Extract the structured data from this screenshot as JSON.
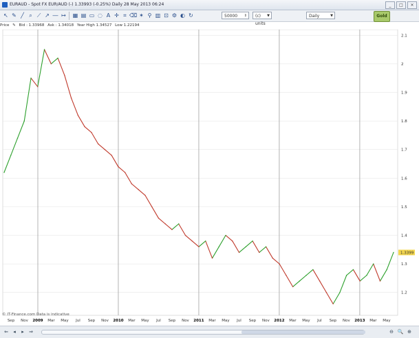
{
  "window": {
    "title": "EURAUD - Spot FX EUR/AUD (-)   1.33993 (-0.25%)   Daily   28 May 2013 06:24",
    "controls": [
      "_",
      "□",
      "×"
    ]
  },
  "toolbar": {
    "icons": [
      "cursor-icon",
      "pencil-icon",
      "line-tool-icon",
      "magnifier-icon",
      "trendline-icon",
      "arrow-line-icon",
      "horizontal-line-icon",
      "vertical-line-icon",
      "fibonacci-icon",
      "channel-icon",
      "rectangle-icon",
      "ellipse-icon",
      "text-icon",
      "crosshair-icon",
      "measure-icon",
      "eraser-icon",
      "star-icon",
      "pin-icon",
      "grid-icon",
      "lock-icon",
      "settings-icon",
      "color-icon",
      "refresh-icon"
    ],
    "quantity_value": "50000",
    "units_select": "(c) units",
    "interval_select": "Daily",
    "logo_text": "Gold"
  },
  "info": {
    "price": "Price",
    "bid": "Bid : 1.33968",
    "ask": "Ask : 1.34018",
    "year_high": "Year High 1.34527",
    "low": "Low 1.22194"
  },
  "chart_data": {
    "type": "line",
    "xlabel": "",
    "ylabel": "",
    "ylim": [
      1.12,
      2.12
    ],
    "yticks": [
      "2.1",
      "2",
      "1.9",
      "1.8",
      "1.7",
      "1.6",
      "1.5",
      "1.4",
      "1.3",
      "1.2"
    ],
    "xticks": [
      "Sep",
      "Nov",
      "2009",
      "Mar",
      "May",
      "Jul",
      "Sep",
      "Nov",
      "2010",
      "Mar",
      "May",
      "Jul",
      "Sep",
      "Nov",
      "2011",
      "Mar",
      "May",
      "Jul",
      "Sep",
      "Nov",
      "2012",
      "Mar",
      "May",
      "Jul",
      "Sep",
      "Nov",
      "2013",
      "Mar",
      "May"
    ],
    "year_ticks": [
      "2009",
      "2010",
      "2011",
      "2012",
      "2013"
    ],
    "last_price_label": "1.3399",
    "series": [
      {
        "x": [
          0,
          1,
          2,
          3,
          4,
          5,
          6,
          7,
          8,
          9,
          10,
          11,
          12,
          13,
          14,
          15,
          16,
          17,
          18,
          19,
          20,
          21,
          22,
          23,
          24,
          25,
          26,
          27,
          28,
          29,
          30,
          31,
          32,
          33,
          34,
          35,
          36,
          37,
          38,
          39,
          40,
          41,
          42,
          43,
          44,
          45,
          46,
          47,
          48,
          49,
          50,
          51,
          52,
          53,
          54,
          55,
          56,
          57,
          58
        ],
        "values": [
          1.62,
          1.68,
          1.74,
          1.8,
          1.95,
          1.92,
          2.05,
          2.0,
          2.02,
          1.96,
          1.88,
          1.82,
          1.78,
          1.76,
          1.72,
          1.7,
          1.68,
          1.64,
          1.62,
          1.58,
          1.56,
          1.54,
          1.5,
          1.46,
          1.44,
          1.42,
          1.44,
          1.4,
          1.38,
          1.36,
          1.38,
          1.32,
          1.36,
          1.4,
          1.38,
          1.34,
          1.36,
          1.38,
          1.34,
          1.36,
          1.32,
          1.3,
          1.26,
          1.22,
          1.24,
          1.26,
          1.28,
          1.24,
          1.2,
          1.16,
          1.2,
          1.26,
          1.28,
          1.24,
          1.26,
          1.3,
          1.24,
          1.28,
          1.34
        ]
      }
    ],
    "colors": {
      "up": "#2ca02c",
      "down": "#c0392b",
      "grid": "#e2e2e2",
      "year_line": "#a0a0a0",
      "price_tag": "#f2d54e"
    }
  },
  "watermark": "© IT-Finance.com  Data is indicative",
  "scrollbar": {
    "left_buttons": [
      "⇐",
      "◂",
      "▸",
      "⇒"
    ],
    "zoom_buttons": [
      "⊖",
      "🔍",
      "⊕"
    ]
  }
}
